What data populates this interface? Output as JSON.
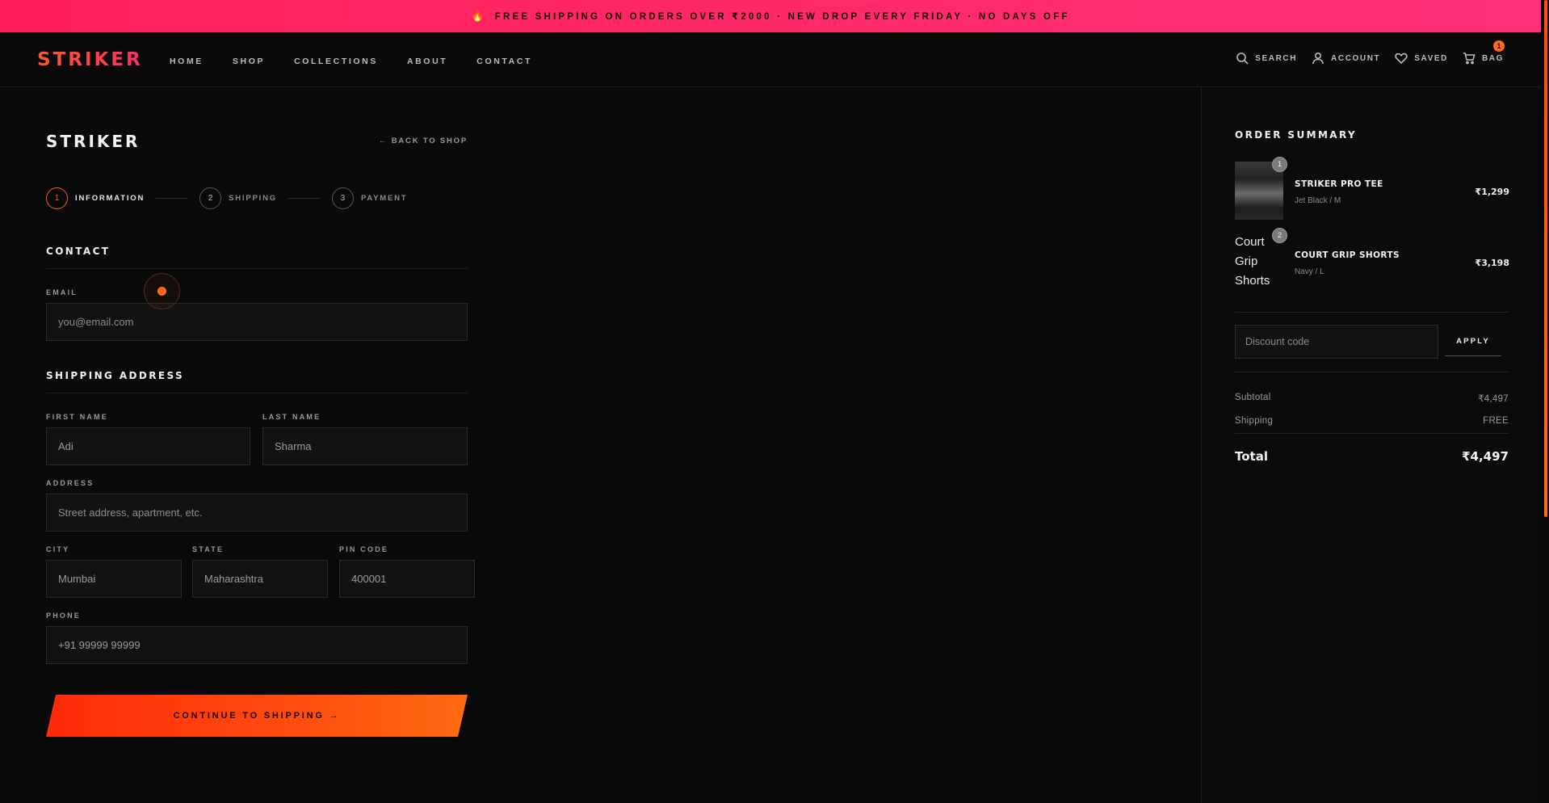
{
  "announcement": {
    "icon": "fire-icon",
    "flame": "🔥",
    "text": "FREE SHIPPING ON ORDERS OVER ₹2000 · NEW DROP EVERY FRIDAY · NO DAYS OFF"
  },
  "header": {
    "logo": "STRIKER",
    "nav": [
      "HOME",
      "SHOP",
      "COLLECTIONS",
      "ABOUT",
      "CONTACT"
    ],
    "search_label": "SEARCH",
    "account_label": "ACCOUNT",
    "saved_label": "SAVED",
    "bag_label": "BAG",
    "bag_count": "1"
  },
  "checkout": {
    "title": "STRIKER",
    "back_link": "← BACK TO SHOP",
    "steps": [
      {
        "num": "1",
        "label": "INFORMATION",
        "active": true
      },
      {
        "num": "2",
        "label": "SHIPPING",
        "active": false
      },
      {
        "num": "3",
        "label": "PAYMENT",
        "active": false
      }
    ],
    "contact_heading": "CONTACT",
    "email_label": "EMAIL",
    "email_placeholder": "you@email.com",
    "shipping_heading": "SHIPPING ADDRESS",
    "first_name_label": "FIRST NAME",
    "first_name_value": "Adi",
    "last_name_label": "LAST NAME",
    "last_name_value": "Sharma",
    "address_label": "ADDRESS",
    "address_placeholder": "Street address, apartment, etc.",
    "city_label": "CITY",
    "city_value": "Mumbai",
    "state_label": "STATE",
    "state_value": "Maharashtra",
    "pin_label": "PIN CODE",
    "pin_value": "400001",
    "phone_label": "PHONE",
    "phone_value": "+91 99999 99999",
    "cta": "CONTINUE TO SHIPPING →"
  },
  "summary": {
    "title": "ORDER SUMMARY",
    "items": [
      {
        "qty": "1",
        "name": "STRIKER PRO TEE",
        "variant": "Jet Black / M",
        "price": "₹1,299"
      },
      {
        "qty": "2",
        "name": "COURT GRIP SHORTS",
        "variant": "Navy / L",
        "price": "₹3,198",
        "alt": "Court Grip Shorts"
      }
    ],
    "discount_placeholder": "Discount code",
    "apply_label": "APPLY",
    "subtotal_label": "Subtotal",
    "subtotal_value": "₹4,497",
    "shipping_label": "Shipping",
    "shipping_value": "FREE",
    "total_label": "Total",
    "total_value": "₹4,497"
  },
  "colors": {
    "accent": "#ff5a1f",
    "announce": "#ff2a6a",
    "background": "#0a0a0a"
  }
}
